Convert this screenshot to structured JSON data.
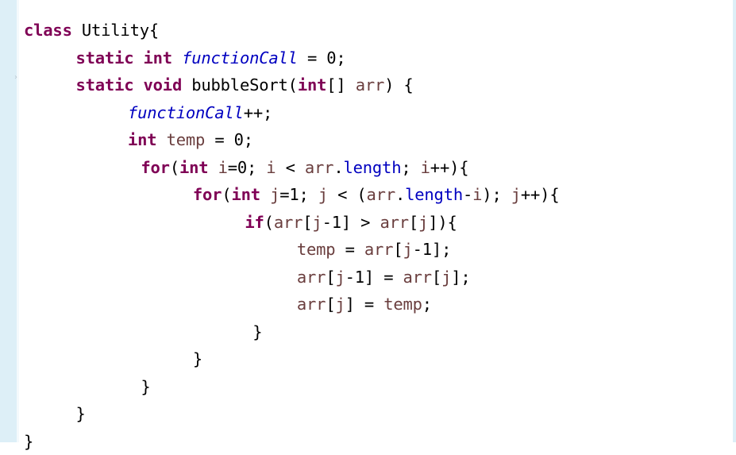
{
  "editor": {
    "language": "java",
    "lines": [
      {
        "indent": 0,
        "tokens": [
          {
            "t": "kw",
            "v": "class"
          },
          {
            "t": "pl",
            "v": " Utility{"
          }
        ]
      },
      {
        "indent": 1,
        "tokens": [
          {
            "t": "kw",
            "v": "static"
          },
          {
            "t": "pl",
            "v": " "
          },
          {
            "t": "kw",
            "v": "int"
          },
          {
            "t": "pl",
            "v": " "
          },
          {
            "t": "sfld",
            "v": "functionCall"
          },
          {
            "t": "pl",
            "v": " = 0;"
          }
        ]
      },
      {
        "indent": 1,
        "tokens": [
          {
            "t": "kw",
            "v": "static"
          },
          {
            "t": "pl",
            "v": " "
          },
          {
            "t": "kw",
            "v": "void"
          },
          {
            "t": "pl",
            "v": " bubbleSort("
          },
          {
            "t": "kw",
            "v": "int"
          },
          {
            "t": "pl",
            "v": "[] "
          },
          {
            "t": "id",
            "v": "arr"
          },
          {
            "t": "pl",
            "v": ") {"
          }
        ]
      },
      {
        "indent": 2,
        "tokens": [
          {
            "t": "sfld",
            "v": "functionCall"
          },
          {
            "t": "pl",
            "v": "++;"
          }
        ]
      },
      {
        "indent": 2,
        "tokens": [
          {
            "t": "kw",
            "v": "int"
          },
          {
            "t": "pl",
            "v": " "
          },
          {
            "t": "id",
            "v": "temp"
          },
          {
            "t": "pl",
            "v": " = 0;"
          }
        ]
      },
      {
        "indent": 2.25,
        "tokens": [
          {
            "t": "kw",
            "v": "for"
          },
          {
            "t": "pl",
            "v": "("
          },
          {
            "t": "kw",
            "v": "int"
          },
          {
            "t": "pl",
            "v": " "
          },
          {
            "t": "id",
            "v": "i"
          },
          {
            "t": "pl",
            "v": "=0; "
          },
          {
            "t": "id",
            "v": "i"
          },
          {
            "t": "pl",
            "v": " < "
          },
          {
            "t": "id",
            "v": "arr"
          },
          {
            "t": "pl",
            "v": "."
          },
          {
            "t": "fld",
            "v": "length"
          },
          {
            "t": "pl",
            "v": "; "
          },
          {
            "t": "id",
            "v": "i"
          },
          {
            "t": "pl",
            "v": "++){"
          }
        ]
      },
      {
        "indent": 3.25,
        "tokens": [
          {
            "t": "kw",
            "v": "for"
          },
          {
            "t": "pl",
            "v": "("
          },
          {
            "t": "kw",
            "v": "int"
          },
          {
            "t": "pl",
            "v": " "
          },
          {
            "t": "id",
            "v": "j"
          },
          {
            "t": "pl",
            "v": "=1; "
          },
          {
            "t": "id",
            "v": "j"
          },
          {
            "t": "pl",
            "v": " < ("
          },
          {
            "t": "id",
            "v": "arr"
          },
          {
            "t": "pl",
            "v": "."
          },
          {
            "t": "fld",
            "v": "length"
          },
          {
            "t": "pl",
            "v": "-"
          },
          {
            "t": "id",
            "v": "i"
          },
          {
            "t": "pl",
            "v": "); "
          },
          {
            "t": "id",
            "v": "j"
          },
          {
            "t": "pl",
            "v": "++){"
          }
        ]
      },
      {
        "indent": 4.25,
        "tokens": [
          {
            "t": "kw",
            "v": "if"
          },
          {
            "t": "pl",
            "v": "("
          },
          {
            "t": "id",
            "v": "arr"
          },
          {
            "t": "pl",
            "v": "["
          },
          {
            "t": "id",
            "v": "j"
          },
          {
            "t": "pl",
            "v": "-1] > "
          },
          {
            "t": "id",
            "v": "arr"
          },
          {
            "t": "pl",
            "v": "["
          },
          {
            "t": "id",
            "v": "j"
          },
          {
            "t": "pl",
            "v": "]){"
          }
        ]
      },
      {
        "indent": 5.25,
        "tokens": [
          {
            "t": "id",
            "v": "temp"
          },
          {
            "t": "pl",
            "v": " = "
          },
          {
            "t": "id",
            "v": "arr"
          },
          {
            "t": "pl",
            "v": "["
          },
          {
            "t": "id",
            "v": "j"
          },
          {
            "t": "pl",
            "v": "-1];"
          }
        ]
      },
      {
        "indent": 5.25,
        "tokens": [
          {
            "t": "id",
            "v": "arr"
          },
          {
            "t": "pl",
            "v": "["
          },
          {
            "t": "id",
            "v": "j"
          },
          {
            "t": "pl",
            "v": "-1] = "
          },
          {
            "t": "id",
            "v": "arr"
          },
          {
            "t": "pl",
            "v": "["
          },
          {
            "t": "id",
            "v": "j"
          },
          {
            "t": "pl",
            "v": "];"
          }
        ]
      },
      {
        "indent": 5.25,
        "tokens": [
          {
            "t": "id",
            "v": "arr"
          },
          {
            "t": "pl",
            "v": "["
          },
          {
            "t": "id",
            "v": "j"
          },
          {
            "t": "pl",
            "v": "] = "
          },
          {
            "t": "id",
            "v": "temp"
          },
          {
            "t": "pl",
            "v": ";"
          }
        ]
      },
      {
        "indent": 4.4,
        "tokens": [
          {
            "t": "pl",
            "v": "}"
          }
        ]
      },
      {
        "indent": 3.25,
        "tokens": [
          {
            "t": "pl",
            "v": "}"
          }
        ]
      },
      {
        "indent": 2.25,
        "tokens": [
          {
            "t": "pl",
            "v": "}"
          }
        ]
      },
      {
        "indent": 1,
        "tokens": [
          {
            "t": "pl",
            "v": "}"
          }
        ]
      },
      {
        "indent": 0,
        "tokens": [
          {
            "t": "pl",
            "v": "}"
          }
        ]
      }
    ]
  }
}
